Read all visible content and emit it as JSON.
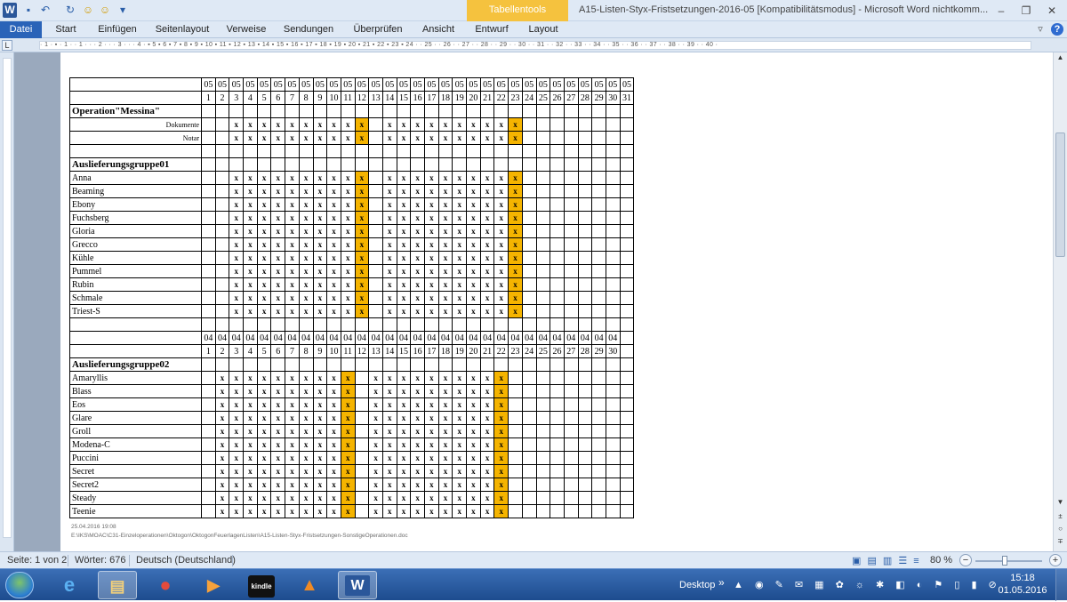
{
  "titlebar": {
    "app_icon": "W",
    "quick_access": [
      {
        "name": "save-icon",
        "glyph": "▪"
      },
      {
        "name": "undo-icon",
        "glyph": "↶"
      },
      {
        "name": "redo-icon",
        "glyph": "↻"
      },
      {
        "name": "smiley-icon",
        "glyph": "☺"
      },
      {
        "name": "smiley-icon",
        "glyph": "☺"
      },
      {
        "name": "customize-qat-icon",
        "glyph": "▾"
      }
    ],
    "contextual_tab_group": "Tabellentools",
    "document_title": "A15-Listen-Styx-Fristsetzungen-2016-05 [Kompatibilitätsmodus] - Microsoft Word nichtkomm...",
    "window_controls": {
      "minimize": "–",
      "restore": "❐",
      "close": "✕"
    }
  },
  "ribbon": {
    "tabs": [
      "Datei",
      "Start",
      "Einfügen",
      "Seitenlayout",
      "Verweise",
      "Sendungen",
      "Überprüfen",
      "Ansicht",
      "Entwurf",
      "Layout"
    ],
    "right": {
      "minimize_ribbon": "▿",
      "help": "?"
    }
  },
  "ruler": {
    "corner": "L",
    "scale": "· 1 · ▪ · 1 · · 1 · · · 2 · · · 3 · · · 4 · ▪ 5 ▪ 6 ▪ 7 ▪ 8 ▪ 9 ▪ 10 ▪ 11 ▪ 12 ▪ 13 ▪ 14 ▪ 15 ▪ 16 ▪ 17 ▪ 18 ▪ 19 ▪ 20 ▪ 21 ▪ 22 ▪ 23 ▪ 24 · · 25 · · 26 · · 27 · · 28 · · 29 · · 30 · · 31 · · 32 · · 33 · · 34 · · 35 · · 36 · · 37 · · 38 · · 39 · · 40 ·"
  },
  "document": {
    "section1": {
      "month_row": [
        "",
        "05",
        "05",
        "05",
        "05",
        "05",
        "05",
        "05",
        "05",
        "05",
        "05",
        "05",
        "05",
        "05",
        "05",
        "05",
        "05",
        "05",
        "05",
        "05",
        "05",
        "05",
        "05",
        "05",
        "05",
        "05",
        "05",
        "05",
        "05",
        "05",
        "05",
        "05"
      ],
      "day_row": [
        "",
        "1",
        "2",
        "3",
        "4",
        "5",
        "6",
        "7",
        "8",
        "9",
        "10",
        "11",
        "12",
        "13",
        "14",
        "15",
        "16",
        "17",
        "18",
        "19",
        "20",
        "21",
        "22",
        "23",
        "24",
        "25",
        "26",
        "27",
        "28",
        "29",
        "30",
        "31"
      ],
      "operation_title": "Operation\"Messina\"",
      "sub_rows": [
        {
          "label": "Dokumente"
        },
        {
          "label": "Notar"
        }
      ],
      "group_title": "Auslieferungsgruppe01",
      "rows": [
        "Anna",
        "Beaming",
        "Ebony",
        "Fuchsberg",
        "Gloria",
        "Grecco",
        "Kühle",
        "Pummel",
        "Rubin",
        "Schmale",
        "Triest-S"
      ],
      "x_days": [
        3,
        4,
        5,
        6,
        7,
        8,
        9,
        10,
        11,
        12,
        14,
        15,
        16,
        17,
        18,
        19,
        20,
        21,
        22,
        23
      ],
      "highlight_days": [
        12,
        23
      ]
    },
    "section2": {
      "month_row": [
        "",
        "04",
        "04",
        "04",
        "04",
        "04",
        "04",
        "04",
        "04",
        "04",
        "04",
        "04",
        "04",
        "04",
        "04",
        "04",
        "04",
        "04",
        "04",
        "04",
        "04",
        "04",
        "04",
        "04",
        "04",
        "04",
        "04",
        "04",
        "04",
        "04",
        "04"
      ],
      "day_row": [
        "",
        "1",
        "2",
        "3",
        "4",
        "5",
        "6",
        "7",
        "8",
        "9",
        "10",
        "11",
        "12",
        "13",
        "14",
        "15",
        "16",
        "17",
        "18",
        "19",
        "20",
        "21",
        "22",
        "23",
        "24",
        "25",
        "26",
        "27",
        "28",
        "29",
        "30"
      ],
      "group_title": "Auslieferungsgruppe02",
      "rows": [
        "Amaryllis",
        "Blass",
        "Eos",
        "Glare",
        "Groll",
        "Modena-C",
        "Puccini",
        "Secret",
        "Secret2",
        "Steady",
        "Teenie"
      ],
      "x_days": [
        2,
        3,
        4,
        5,
        6,
        7,
        8,
        9,
        10,
        11,
        13,
        14,
        15,
        16,
        17,
        18,
        19,
        20,
        21,
        22
      ],
      "highlight_days": [
        11,
        22
      ]
    },
    "cell_mark": "x",
    "highlight_color": "#f5b400",
    "footer_date": "25.04.2016 19:08",
    "footer_path": "E:\\IKS\\MOAC\\C31-Einzeloperationen\\Oktogon\\OktogonFeuerlagenListen\\A15-Listen-Styx-Fristsetzungen-SonstigeOperationen.doc"
  },
  "statusbar": {
    "page": "Seite: 1 von 2",
    "words": "Wörter: 676",
    "language": "Deutsch (Deutschland)",
    "view_icons": "▣ ▤ ▥ ☰ ≡",
    "zoom": "80 %",
    "zoom_minus": "−",
    "zoom_plus": "+"
  },
  "taskbar": {
    "apps": [
      {
        "name": "taskbar-ie-icon",
        "glyph": "e",
        "color": "#3d9be9"
      },
      {
        "name": "taskbar-explorer-icon",
        "glyph": "▤",
        "color": "#e8c26a"
      },
      {
        "name": "taskbar-chrome-icon",
        "glyph": "●",
        "color": "#e34b3c"
      },
      {
        "name": "taskbar-mediaplayer-icon",
        "glyph": "▶",
        "color": "#f08a24"
      },
      {
        "name": "taskbar-kindle-icon",
        "glyph": "kindle",
        "color": "#111111"
      },
      {
        "name": "taskbar-vlc-icon",
        "glyph": "▲",
        "color": "#f07b0e"
      },
      {
        "name": "taskbar-word-icon",
        "glyph": "W",
        "color": "#2b579a"
      }
    ],
    "desktop_label": "Desktop",
    "desktop_chevron": "»",
    "tray": "▲ ◉ ✎ ✉ ▦ ✿ ☼ ✱ ◧ ◐ ⚑ ▯ ▮ ⊘",
    "time": "15:18",
    "date": "01.05.2016"
  }
}
